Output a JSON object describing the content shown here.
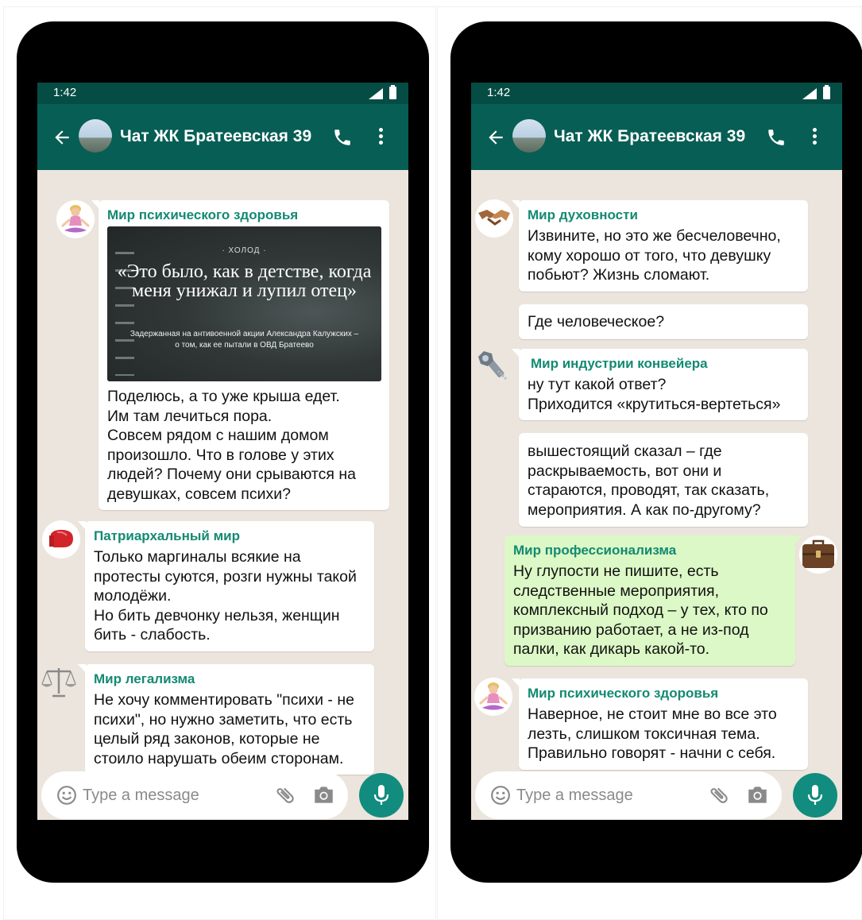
{
  "left_phone": {
    "status": {
      "time": "1:42"
    },
    "header": {
      "title": "Чат ЖК Братеевская 39"
    },
    "messages": [
      {
        "sender": "Мир психического здоровья",
        "avatar_icon": "meditating-woman-icon",
        "preview": {
          "kicker": "· ХОЛОД ·",
          "headline": "«Это было, как в детстве, когда меня унижал и лупил отец»",
          "subtitle": "Задержанная на антивоенной акции Александра Калужских –\nо том, как ее пытали в ОВД Братеево"
        },
        "text": "Поделюсь, а то уже крыша едет.\nИм там лечиться пора.\nСовсем рядом с нашим домом произошло. Что в голове у этих людей? Почему они срываются на девушках, совсем психи?"
      },
      {
        "sender": "Патриархальный мир",
        "avatar_icon": "boxing-glove-icon",
        "text": "Только маргиналы всякие на протесты суются, розги нужны такой молодёжи.\nНо бить девчонку нельзя, женщин бить - слабость."
      },
      {
        "sender": "Мир легализма",
        "avatar_icon": "scales-icon",
        "text": "Не хочу комментировать  \"психи - не психи\", но нужно заметить, что есть целый ряд законов, которые не стоило нарушать обеим сторонам."
      }
    ],
    "input": {
      "placeholder": "Type a message"
    }
  },
  "right_phone": {
    "status": {
      "time": "1:42"
    },
    "header": {
      "title": "Чат ЖК Братеевская 39"
    },
    "messages": [
      {
        "sender": "Мир духовности",
        "avatar_icon": "handshake-icon",
        "text": "Извините, но это же бесчеловечно, кому хорошо от того, что девушку побьют?  Жизнь сломают."
      },
      {
        "text": "Где человеческое?"
      },
      {
        "sender": "Мир индустрии конвейера",
        "avatar_icon": "nut-bolt-icon",
        "text": "ну тут какой ответ?\nПриходится «крутиться-вертеться»"
      },
      {
        "text": "вышестоящий сказал – где раскрываемость, вот они и стараются, проводят, так сказать, мероприятия. А как по-другому?"
      },
      {
        "sender": "Мир профессионализма",
        "avatar_icon": "briefcase-icon",
        "outgoing": true,
        "text": "Ну глупости не пишите, есть следственные мероприятия, комплексный подход – у тех, кто по призванию работает, а не из-под палки, как дикарь какой-то."
      },
      {
        "sender": "Мир психического здоровья",
        "avatar_icon": "meditating-woman-icon",
        "text": "Наверное, не стоит мне во все это лезть, слишком токсичная тема. Правильно говорят - начни с себя."
      }
    ],
    "input": {
      "placeholder": "Type a message"
    }
  },
  "colors": {
    "header": "#075e54",
    "status_bar": "#054d44",
    "chat_background": "#ece5dd",
    "sender_name": "#138a72",
    "outgoing_bubble": "#dcf8c6",
    "mic_button": "#128c7e"
  }
}
